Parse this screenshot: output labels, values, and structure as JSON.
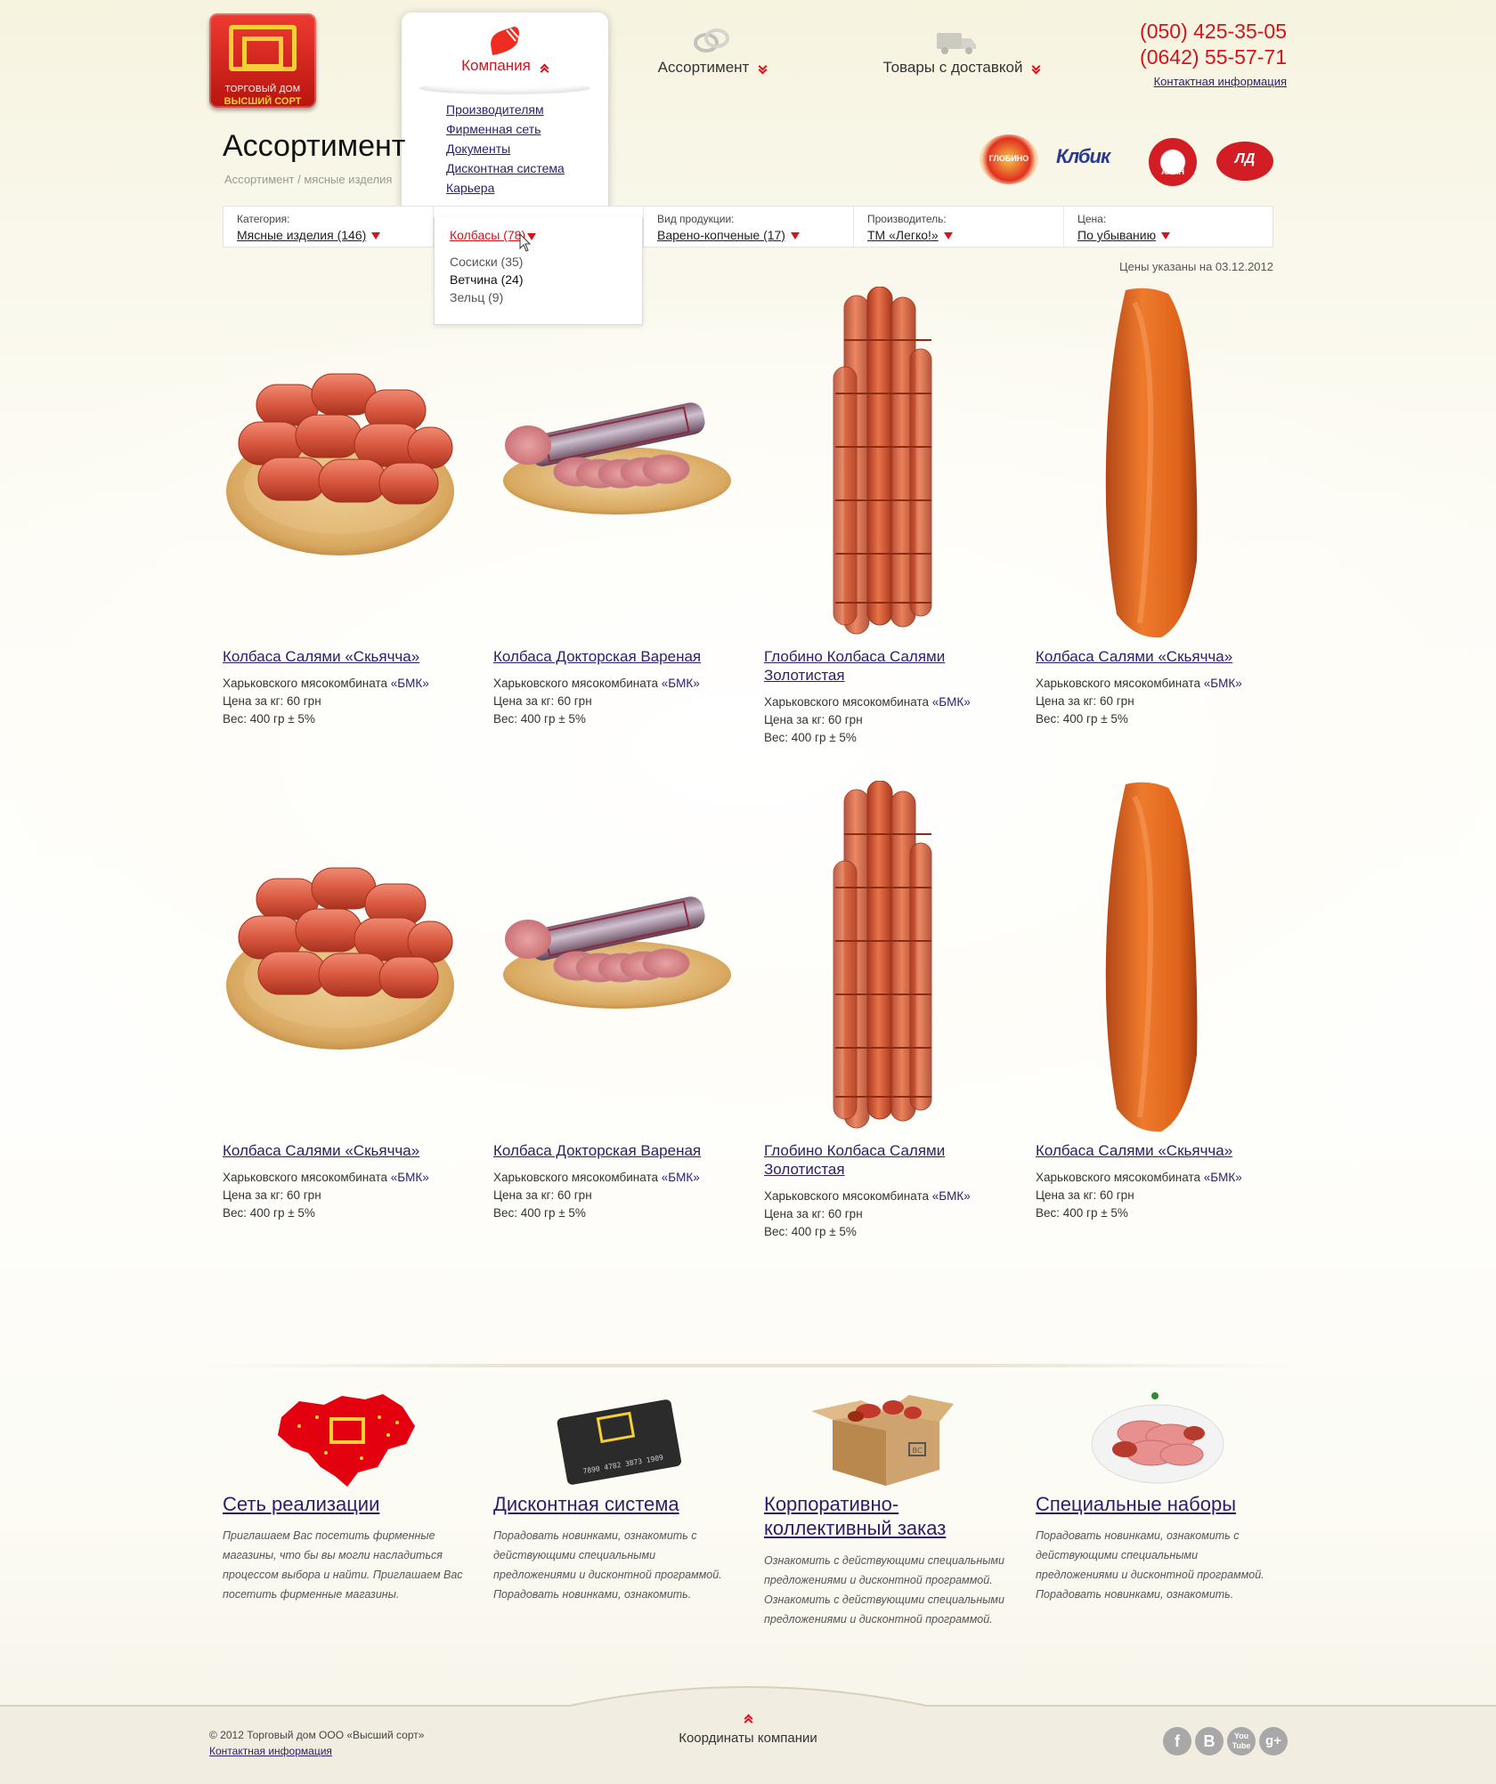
{
  "logo": {
    "line1": "ТОРГОВЫЙ ДОМ",
    "line2": "ВЫСШИЙ СОРТ"
  },
  "nav": {
    "company": "Компания",
    "assortment": "Ассортимент",
    "delivery": "Товары с доставкой",
    "submenu": [
      "Производителям",
      "Фирменная сеть",
      "Документы",
      "Дисконтная система",
      "Карьера"
    ]
  },
  "header": {
    "phone1": "(050) 425-35-05",
    "phone2": "(0642) 55-57-71",
    "contact": "Контактная информация"
  },
  "page": {
    "title": "Ассортимент",
    "breadcrumb": "Ассортимент / мясные изделия"
  },
  "filters": {
    "category": {
      "label": "Категория:",
      "value": "Мясные изделия (146)"
    },
    "subcategory": {
      "value": "Колбасы (78)",
      "options": [
        "Сосиски (35)",
        "Ветчина (24)",
        "Зельц (9)"
      ]
    },
    "type": {
      "label": "Вид продукции:",
      "value": "Варено-копченые (17)"
    },
    "maker": {
      "label": "Производитель:",
      "value": "ТМ «Легко!»"
    },
    "price": {
      "label": "Цена:",
      "value": "По убыванию"
    }
  },
  "prices_note": "Цены указаны на 03.12.2012",
  "products": [
    {
      "title": "Колбаса Салями «Скьячча»",
      "maker_text": "Харьковского мясокомбината",
      "maker_link": "«БМК»",
      "price": "Цена за кг: 60 грн",
      "weight": "Вес: 400 гр ± 5%"
    },
    {
      "title": "Колбаса Докторская Вареная",
      "maker_text": "Харьковского мясокомбината",
      "maker_link": "«БМК»",
      "price": "Цена за кг: 60 грн",
      "weight": "Вес: 400 гр ± 5%"
    },
    {
      "title": "Глобино Колбаса Салями Золотистая",
      "maker_text": "Харьковского мясокомбината",
      "maker_link": "«БМК»",
      "price": "Цена за кг: 60 грн",
      "weight": "Вес: 400 гр ± 5%"
    },
    {
      "title": "Колбаса Салями «Скьячча»",
      "maker_text": "Харьковского мясокомбината",
      "maker_link": "«БМК»",
      "price": "Цена за кг: 60 грн",
      "weight": "Вес: 400 гр ± 5%"
    },
    {
      "title": "Колбаса Салями «Скьячча»",
      "maker_text": "Харьковского мясокомбината",
      "maker_link": "«БМК»",
      "price": "Цена за кг: 60 грн",
      "weight": "Вес: 400 гр ± 5%"
    },
    {
      "title": "Колбаса Докторская Вареная",
      "maker_text": "Харьковского мясокомбината",
      "maker_link": "«БМК»",
      "price": "Цена за кг: 60 грн",
      "weight": "Вес: 400 гр ± 5%"
    },
    {
      "title": "Глобино Колбаса Салями Золотистая",
      "maker_text": "Харьковского мясокомбината",
      "maker_link": "«БМК»",
      "price": "Цена за кг: 60 грн",
      "weight": "Вес: 400 гр ± 5%"
    },
    {
      "title": "Колбаса Салями «Скьячча»",
      "maker_text": "Харьковского мясокомбината",
      "maker_link": "«БМК»",
      "price": "Цена за кг: 60 грн",
      "weight": "Вес: 400 гр ± 5%"
    }
  ],
  "features": [
    {
      "title": "Сеть реализации",
      "text": "Приглашаем Вас посетить фирменные магазины, что бы вы могли насладиться процессом выбора и найти. Приглашаем Вас посетить фирменные магазины."
    },
    {
      "title": "Дисконтная система",
      "text": "Порадовать новинками, ознакомить с действующими специальными предложениями и дисконтной программой. Порадовать новинками, ознакомить."
    },
    {
      "title": "Корпоративно-коллективный заказ",
      "text": "Ознакомить с действующими специальными предложениями и дисконтной программой. Ознакомить с действующими специальными предложениями и дисконтной программой."
    },
    {
      "title": "Специальные наборы",
      "text": "Порадовать новинками, ознакомить с действующими специальными предложениями и дисконтной программой. Порадовать новинками, ознакомить."
    }
  ],
  "card_number": "7890 4782 3873 1909",
  "box_logo": "ВС",
  "footer": {
    "copyright": "© 2012 Торговый дом ООО «Высший сорт»",
    "contact": "Контактная информация",
    "coords": "Координаты компании"
  },
  "social": [
    "f",
    "B",
    "You Tube",
    "g+"
  ],
  "brands": [
    "ГЛОБИНО",
    "Клбик",
    "АЛАН",
    "ЛД"
  ],
  "colors": {
    "accent": "#d4131c",
    "link": "#2c1e6b",
    "brand_gold": "#f5cf36"
  }
}
